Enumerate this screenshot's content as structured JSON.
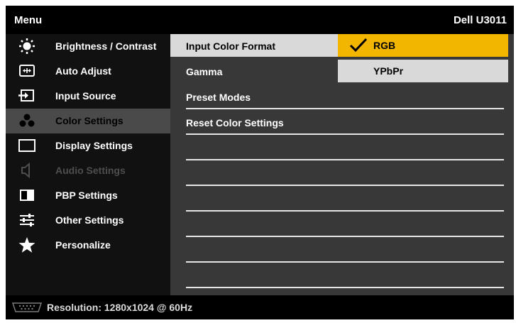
{
  "header": {
    "title": "Menu",
    "model": "Dell U3011"
  },
  "menu": [
    {
      "label": "Brightness / Contrast",
      "icon": "brightness-icon"
    },
    {
      "label": "Auto Adjust",
      "icon": "auto-adjust-icon"
    },
    {
      "label": "Input Source",
      "icon": "input-source-icon"
    },
    {
      "label": "Color Settings",
      "icon": "color-settings-icon",
      "selected": true
    },
    {
      "label": "Display Settings",
      "icon": "display-settings-icon"
    },
    {
      "label": "Audio Settings",
      "icon": "speaker-icon",
      "disabled": true
    },
    {
      "label": "PBP Settings",
      "icon": "pbp-icon"
    },
    {
      "label": "Other Settings",
      "icon": "sliders-icon"
    },
    {
      "label": "Personalize",
      "icon": "star-icon"
    }
  ],
  "submenu": [
    {
      "label": "Input Color Format",
      "selected": true
    },
    {
      "label": "Gamma"
    },
    {
      "label": "Preset Modes"
    },
    {
      "label": "Reset Color Settings"
    }
  ],
  "options": [
    {
      "label": "RGB",
      "checked": true
    },
    {
      "label": "YPbPr"
    }
  ],
  "footer": {
    "resolution": "Resolution: 1280x1024 @ 60Hz"
  },
  "colors": {
    "accent": "#f3b600",
    "highlight": "#d9d9d9",
    "panel": "#383838"
  }
}
